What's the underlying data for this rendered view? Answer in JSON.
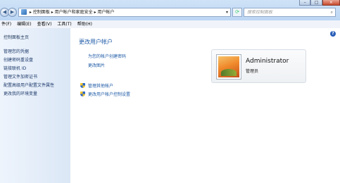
{
  "address": {
    "path": "▸ 控制面板 ▸ 用户帐户和家庭安全 ▸ 用户帐户",
    "search_placeholder": "搜索控制面板"
  },
  "menu": [
    "件(F)",
    "编辑(E)",
    "查看(V)",
    "工具(T)",
    "帮助(H)"
  ],
  "sidebar": {
    "home": "控制面板主页",
    "items": [
      "管理您的凭据",
      "创建密码重设盘",
      "链接联机 ID",
      "管理文件加密证书",
      "配置高级用户配置文件属性",
      "更改我的环境变量"
    ]
  },
  "main": {
    "title": "更改用户帐户",
    "link_create_password": "为您的帐户创建密码",
    "link_change_picture": "更改图片",
    "link_manage_accounts": "管理其他帐户",
    "link_uac": "更改用户帐户控制设置"
  },
  "user": {
    "name": "Administrator",
    "role": "管理员"
  }
}
